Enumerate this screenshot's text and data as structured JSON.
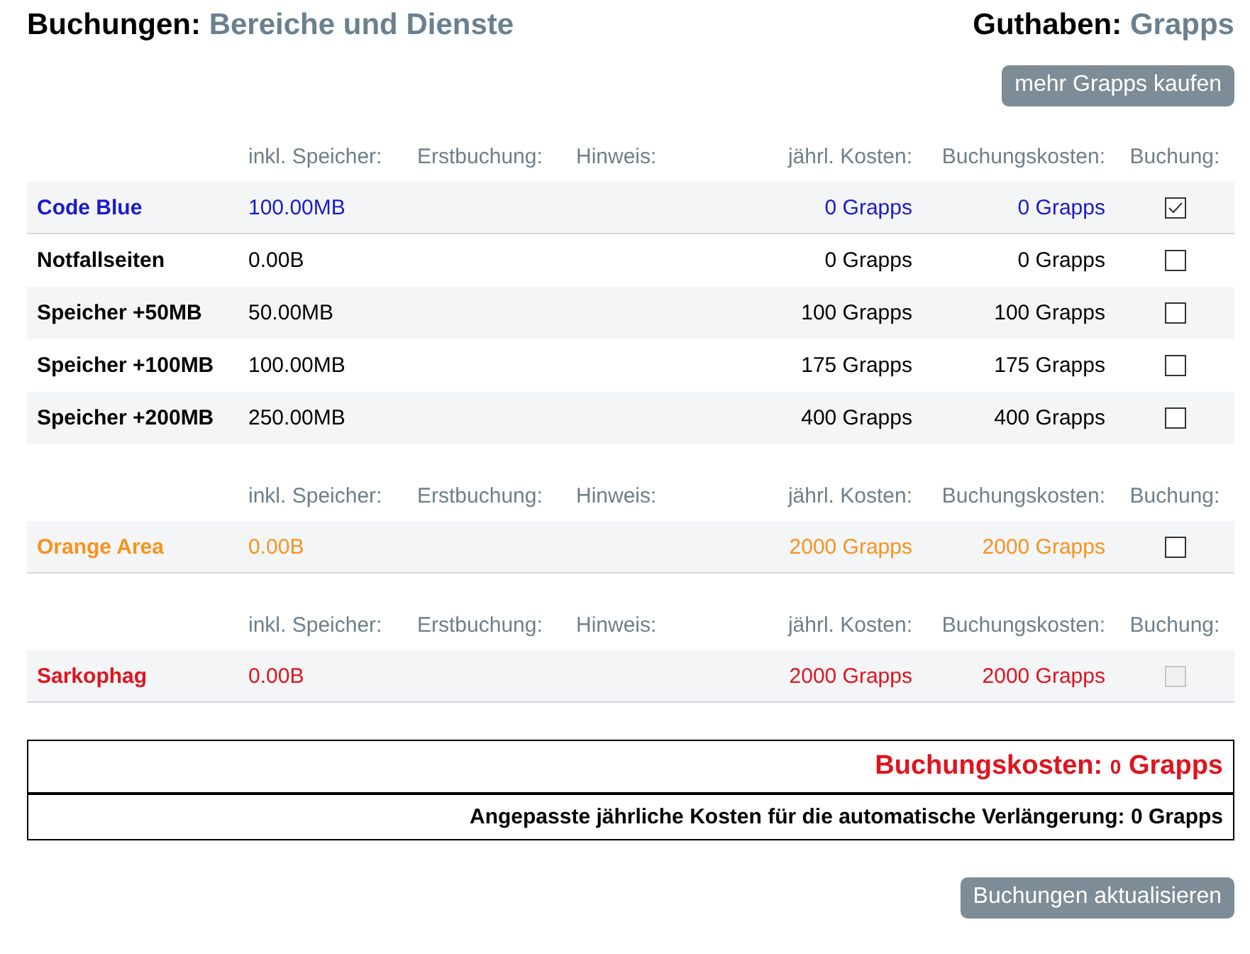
{
  "title": {
    "label": "Buchungen:",
    "value": "Bereiche und Dienste"
  },
  "balance": {
    "label": "Guthaben:",
    "value": "Grapps"
  },
  "buy_button": "mehr Grapps kaufen",
  "sections": [
    {
      "columns": [
        "inkl. Speicher:",
        "Erstbuchung:",
        "Hinweis:",
        "jährl. Kosten:",
        "Buchungskosten:",
        "Buchung:"
      ],
      "rows": [
        {
          "name": "Code Blue",
          "storage": "100.00MB",
          "annual": "0 Grapps",
          "booking": "0 Grapps",
          "checked": true,
          "disabled": false,
          "color": "#1a1acc"
        },
        {
          "name": "Notfallseiten",
          "storage": "0.00B",
          "annual": "0 Grapps",
          "booking": "0 Grapps",
          "checked": false,
          "disabled": false,
          "color": "#000000"
        },
        {
          "name": "Speicher +50MB",
          "storage": "50.00MB",
          "annual": "100 Grapps",
          "booking": "100 Grapps",
          "checked": false,
          "disabled": false,
          "color": "#000000"
        },
        {
          "name": "Speicher +100MB",
          "storage": "100.00MB",
          "annual": "175 Grapps",
          "booking": "175 Grapps",
          "checked": false,
          "disabled": false,
          "color": "#000000"
        },
        {
          "name": "Speicher +200MB",
          "storage": "250.00MB",
          "annual": "400 Grapps",
          "booking": "400 Grapps",
          "checked": false,
          "disabled": false,
          "color": "#000000"
        }
      ]
    },
    {
      "columns": [
        "inkl. Speicher:",
        "Erstbuchung:",
        "Hinweis:",
        "jährl. Kosten:",
        "Buchungskosten:",
        "Buchung:"
      ],
      "rows": [
        {
          "name": "Orange Area",
          "storage": "0.00B",
          "annual": "2000 Grapps",
          "booking": "2000 Grapps",
          "checked": false,
          "disabled": false,
          "color": "#f7931e"
        }
      ]
    },
    {
      "columns": [
        "inkl. Speicher:",
        "Erstbuchung:",
        "Hinweis:",
        "jährl. Kosten:",
        "Buchungskosten:",
        "Buchung:"
      ],
      "rows": [
        {
          "name": "Sarkophag",
          "storage": "0.00B",
          "annual": "2000 Grapps",
          "booking": "2000 Grapps",
          "checked": false,
          "disabled": true,
          "color": "#e0141e"
        }
      ]
    }
  ],
  "total": {
    "label": "Buchungskosten:",
    "amount": "0",
    "unit": "Grapps"
  },
  "renewal": "Angepasste jährliche Kosten für die automatische Verlängerung: 0 Grapps",
  "update_button": "Buchungen aktualisieren"
}
